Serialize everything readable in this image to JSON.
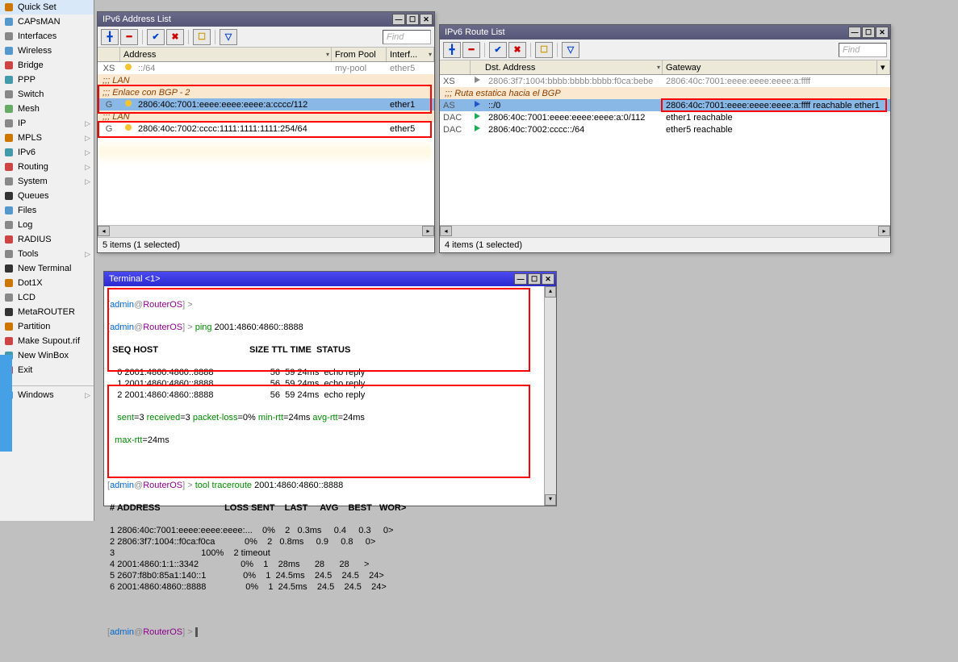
{
  "sidebar": {
    "items": [
      {
        "label": "Quick Set",
        "arrow": false
      },
      {
        "label": "CAPsMAN",
        "arrow": false
      },
      {
        "label": "Interfaces",
        "arrow": false
      },
      {
        "label": "Wireless",
        "arrow": false
      },
      {
        "label": "Bridge",
        "arrow": false
      },
      {
        "label": "PPP",
        "arrow": false
      },
      {
        "label": "Switch",
        "arrow": false
      },
      {
        "label": "Mesh",
        "arrow": false
      },
      {
        "label": "IP",
        "arrow": true
      },
      {
        "label": "MPLS",
        "arrow": true
      },
      {
        "label": "IPv6",
        "arrow": true
      },
      {
        "label": "Routing",
        "arrow": true
      },
      {
        "label": "System",
        "arrow": true
      },
      {
        "label": "Queues",
        "arrow": false
      },
      {
        "label": "Files",
        "arrow": false
      },
      {
        "label": "Log",
        "arrow": false
      },
      {
        "label": "RADIUS",
        "arrow": false
      },
      {
        "label": "Tools",
        "arrow": true
      },
      {
        "label": "New Terminal",
        "arrow": false
      },
      {
        "label": "Dot1X",
        "arrow": false
      },
      {
        "label": "LCD",
        "arrow": false
      },
      {
        "label": "MetaROUTER",
        "arrow": false
      },
      {
        "label": "Partition",
        "arrow": false
      },
      {
        "label": "Make Supout.rif",
        "arrow": false
      },
      {
        "label": "New WinBox",
        "arrow": false
      },
      {
        "label": "Exit",
        "arrow": false
      }
    ],
    "bottom": [
      {
        "label": "Windows",
        "arrow": true
      }
    ]
  },
  "addr_win": {
    "title": "IPv6 Address List",
    "find": "Find",
    "headers": {
      "address": "Address",
      "from_pool": "From Pool",
      "interface": "Interf..."
    },
    "rows": [
      {
        "flag": "XS",
        "addr": "::/64",
        "pool": "my-pool",
        "intf": "ether5",
        "xs": true,
        "yellow": true
      },
      {
        "comment": ";;; LAN"
      },
      {
        "comment": ";;; Enlace con BGP - 2",
        "hl": true
      },
      {
        "flag": "G",
        "addr": "2806:40c:7001:eeee:eeee:eeee:a:cccc/112",
        "pool": "",
        "intf": "ether1",
        "selected": true,
        "yellow": true
      },
      {
        "comment": ";;; LAN"
      },
      {
        "flag": "G",
        "addr": "2806:40c:7002:cccc:1111:1111:1111:254/64",
        "pool": "",
        "intf": "ether5",
        "yellow": true
      }
    ],
    "status": "5 items (1 selected)"
  },
  "route_win": {
    "title": "IPv6 Route List",
    "find": "Find",
    "headers": {
      "dst": "Dst. Address",
      "gw": "Gateway"
    },
    "rows": [
      {
        "flag": "XS",
        "dst": "2806:3f7:1004:bbbb:bbbb:bbbb:f0ca:bebe",
        "gw": "2806:40c:7001:eeee:eeee:eeee:a:ffff",
        "xs": true
      },
      {
        "comment": ";;; Ruta estatica hacia el BGP"
      },
      {
        "flag": "AS",
        "dst": "::/0",
        "gw": "2806:40c:7001:eeee:eeee:eeee:a:ffff reachable ether1",
        "selected": true,
        "gwred": true
      },
      {
        "flag": "DAC",
        "dst": "2806:40c:7001:eeee:eeee:eeee:a:0/112",
        "gw": "ether1 reachable"
      },
      {
        "flag": "DAC",
        "dst": "2806:40c:7002:cccc::/64",
        "gw": "ether5 reachable"
      }
    ],
    "status": "4 items (1 selected)"
  },
  "terminal": {
    "title": "Terminal <1>",
    "prompt_user": "admin",
    "prompt_at": "@",
    "prompt_host": "RouterOS",
    "prompt_gt": "] > ",
    "ping_cmd": "ping",
    "ping_target": "2001:4860:4860::8888",
    "ping_header": "  SEQ HOST                                     SIZE TTL TIME  STATUS",
    "ping_rows": [
      "    0 2001:4860:4860::8888                       56  59 24ms  echo reply",
      "    1 2001:4860:4860::8888                       56  59 24ms  echo reply",
      "    2 2001:4860:4860::8888                       56  59 24ms  echo reply"
    ],
    "ping_summary_sent": "sent",
    "ping_summary_sent_v": "=3 ",
    "ping_summary_recv": "received",
    "ping_summary_recv_v": "=3 ",
    "ping_summary_pl": "packet-loss",
    "ping_summary_pl_v": "=0% ",
    "ping_summary_min": "min-rtt",
    "ping_summary_min_v": "=24ms ",
    "ping_summary_avg": "avg-rtt",
    "ping_summary_avg_v": "=24ms ",
    "ping_summary_max": "   max-rtt",
    "ping_summary_max_v": "=24ms",
    "trace_cmd": "tool traceroute",
    "trace_target": "2001:4860:4860::8888",
    "trace_header": " # ADDRESS                          LOSS SENT    LAST     AVG    BEST   WOR>",
    "trace_rows": [
      " 1 2806:40c:7001:eeee:eeee:eeee:...    0%    2   0.3ms     0.4     0.3     0>",
      " 2 2806:3f7:1004::f0ca:f0ca            0%    2   0.8ms     0.9     0.8     0>",
      " 3                                   100%    2 timeout",
      " 4 2001:4860:1:1::3342                 0%    1    28ms      28      28      >",
      " 5 2607:f8b0:85a1:140::1               0%    1  24.5ms    24.5    24.5    24>",
      " 6 2001:4860:4860::8888                0%    1  24.5ms    24.5    24.5    24>"
    ]
  }
}
